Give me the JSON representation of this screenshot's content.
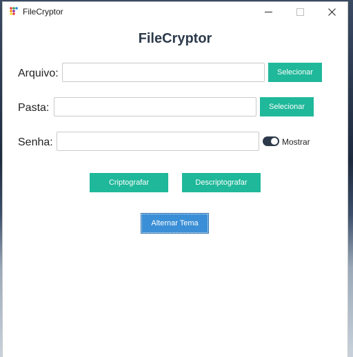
{
  "window": {
    "title": "FileCryptor",
    "controls": {
      "minimize": "minimize",
      "maximize": "maximize",
      "close": "close"
    }
  },
  "main": {
    "heading": "FileCryptor",
    "arquivo": {
      "label": "Arquivo:",
      "value": "",
      "button": "Selecionar"
    },
    "pasta": {
      "label": "Pasta:",
      "value": "",
      "button": "Selecionar"
    },
    "senha": {
      "label": "Senha:",
      "value": "",
      "toggle_label": "Mostrar",
      "toggle_on": true
    },
    "actions": {
      "encrypt": "Criptografar",
      "decrypt": "Descriptografar"
    },
    "theme_button": "Alternar Tema"
  },
  "colors": {
    "accent_teal": "#1fb89a",
    "theme_button": "#3b8fd6",
    "heading": "#2c3a4b",
    "toggle": "#2c3a4b"
  },
  "icons": [
    "app-logo-icon",
    "minimize-icon",
    "maximize-icon",
    "close-icon"
  ]
}
